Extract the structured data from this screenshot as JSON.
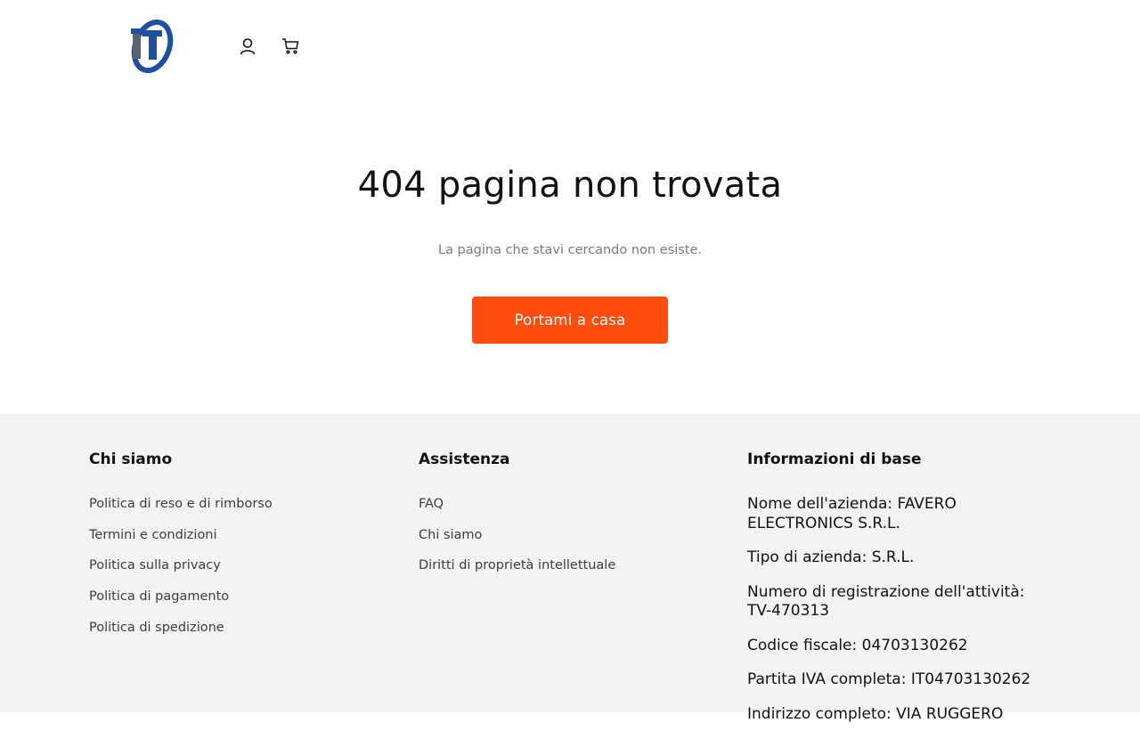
{
  "header": {
    "logo_text": "IT",
    "icons": {
      "account": "user-icon",
      "cart": "cart-icon"
    }
  },
  "main": {
    "title": "404 pagina non trovata",
    "subtitle": "La pagina che stavi cercando non esiste.",
    "button_label": "Portami a casa"
  },
  "footer": {
    "col1": {
      "heading": "Chi siamo",
      "links": [
        "Politica di reso e di rimborso",
        "Termini e condizioni",
        "Politica sulla privacy",
        "Politica di pagamento",
        "Politica di spedizione"
      ]
    },
    "col2": {
      "heading": "Assistenza",
      "links": [
        "FAQ",
        "Chi siamo",
        "Diritti di proprietà intellettuale"
      ]
    },
    "col3": {
      "heading": "Informazioni di base",
      "items": [
        "Nome dell'azienda: FAVERO ELECTRONICS S.R.L.",
        "Tipo di azienda: S.R.L.",
        "Numero di registrazione dell'attività: TV-470313",
        "Codice fiscale: 04703130262",
        "Partita IVA completa: IT04703130262",
        "Indirizzo completo: VIA RUGGERO"
      ]
    }
  },
  "colors": {
    "accent": "#ff4d0d",
    "footer_bg": "#f3f3f3",
    "logo_blue": "#1f4fa0",
    "logo_gray": "#5a6470"
  }
}
